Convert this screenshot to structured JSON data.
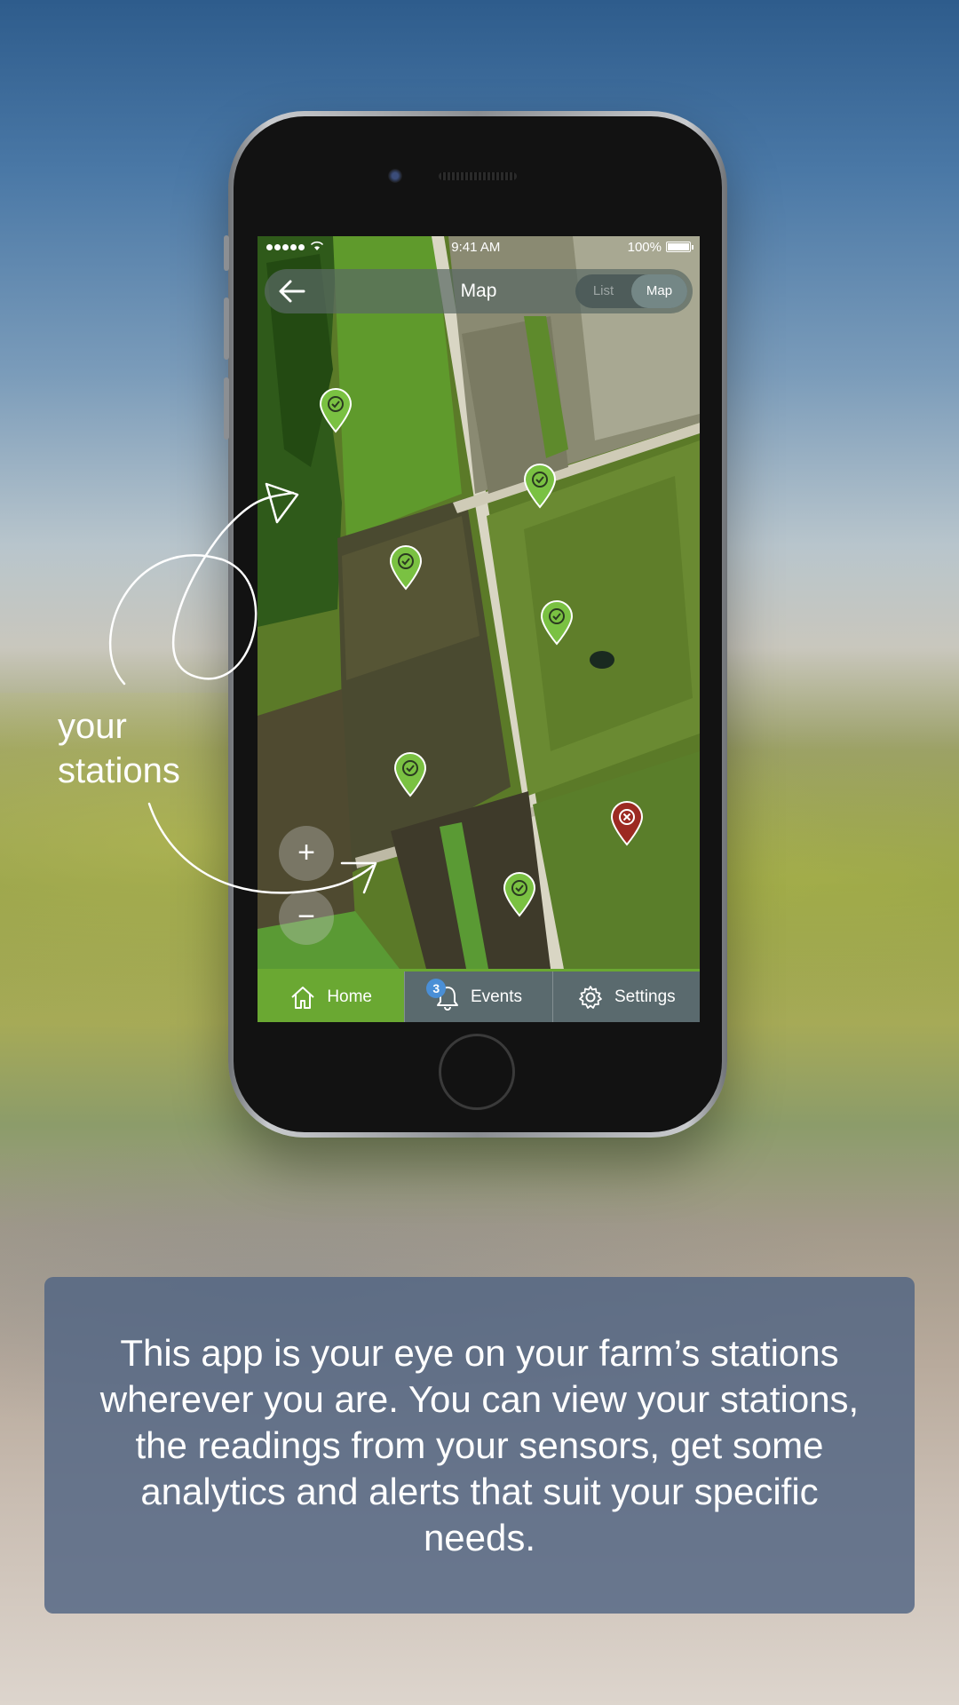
{
  "status_bar": {
    "time": "9:41 AM",
    "battery": "100%",
    "signal_dots_filled": 5
  },
  "nav": {
    "back_icon": "arrow-left-icon",
    "title": "Map",
    "segments": [
      "List",
      "Map"
    ],
    "active_segment": "Map"
  },
  "map_controls": {
    "zoom_in": "+",
    "zoom_out": "−"
  },
  "pins": [
    {
      "status": "ok",
      "color": "#7ac142"
    },
    {
      "status": "ok",
      "color": "#7ac142"
    },
    {
      "status": "ok",
      "color": "#7ac142"
    },
    {
      "status": "ok",
      "color": "#7ac142"
    },
    {
      "status": "ok",
      "color": "#7ac142"
    },
    {
      "status": "ok",
      "color": "#7ac142"
    },
    {
      "status": "error",
      "color": "#9c2a22"
    }
  ],
  "tabs": [
    {
      "label": "Home",
      "icon": "home-icon",
      "active": true
    },
    {
      "label": "Events",
      "icon": "bell-icon",
      "badge": "3",
      "active": false
    },
    {
      "label": "Settings",
      "icon": "gear-icon",
      "active": false
    }
  ],
  "annotation": {
    "line1": "your",
    "line2": "stations"
  },
  "caption": "This app is your eye on your farm’s stations wherever you are. You can view your stations, the readings from your sensors, get some analytics and alerts that suit your specific needs.",
  "colors": {
    "accent": "#6aa832",
    "tab_bar": "#5a6a6e",
    "badge": "#4a8fd6",
    "caption_bg": "#50648a"
  }
}
